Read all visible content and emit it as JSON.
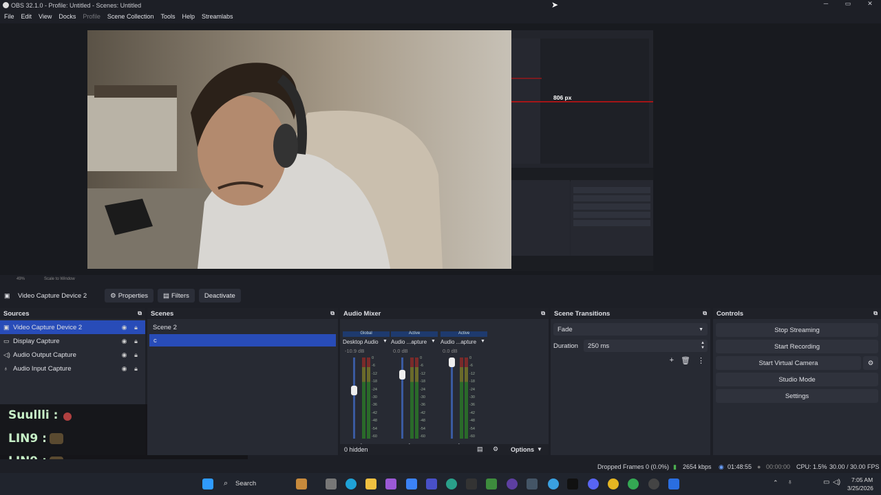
{
  "window": {
    "title": "OBS 32.1.0 - Profile: Untitled - Scenes: Untitled",
    "minimize": "─",
    "maximize": "▭",
    "close": "✕"
  },
  "menu": [
    "File",
    "Edit",
    "View",
    "Docks",
    "Profile",
    "Scene Collection",
    "Tools",
    "Help",
    "Streamlabs"
  ],
  "preview": {
    "overlay_label": "806 px"
  },
  "zoom": {
    "level": "49%",
    "mode": "Scale to Window"
  },
  "source_toolbar": {
    "source_name": "Video Capture Device 2",
    "properties": "Properties",
    "filters": "Filters",
    "deactivate": "Deactivate"
  },
  "sources": {
    "title": "Sources",
    "items": [
      {
        "name": "Video Capture Device 2",
        "icon": "camera-icon"
      },
      {
        "name": "Display Capture",
        "icon": "monitor-icon"
      },
      {
        "name": "Audio Output Capture",
        "icon": "speaker-icon"
      },
      {
        "name": "Audio Input Capture",
        "icon": "microphone-icon"
      }
    ]
  },
  "scenes": {
    "title": "Scenes",
    "items": [
      "Scene 2",
      "c"
    ]
  },
  "mixer": {
    "title": "Audio Mixer",
    "channels": [
      {
        "tag": "Global",
        "name": "Desktop Audio",
        "db": "-10.9 dB",
        "level": 0.35
      },
      {
        "tag": "Active",
        "name": "Audio ...apture",
        "db": "0.0 dB",
        "level": 0.15
      },
      {
        "tag": "Active",
        "name": "Audio ...apture",
        "db": "0.0 dB",
        "level": 0.0
      }
    ],
    "scale": [
      "0",
      "-6",
      "-12",
      "-18",
      "-24",
      "-30",
      "-36",
      "-42",
      "-48",
      "-54",
      "-60"
    ],
    "hidden": "0 hidden",
    "options": "Options"
  },
  "transitions": {
    "title": "Scene Transitions",
    "type": "Fade",
    "duration_label": "Duration",
    "duration": "250 ms"
  },
  "controls": {
    "title": "Controls",
    "stop_streaming": "Stop Streaming",
    "start_recording": "Start Recording",
    "start_virtual_camera": "Start Virtual Camera",
    "studio_mode": "Studio Mode",
    "settings": "Settings"
  },
  "chat": [
    {
      "user": "Suullli :"
    },
    {
      "user": "LIN9 :"
    },
    {
      "user": "LIN9 :"
    }
  ],
  "status": {
    "dropped": "Dropped Frames 0 (0.0%)",
    "bitrate": "2654 kbps",
    "stream_time": "01:48:55",
    "rec_time": "00:00:00",
    "cpu": "CPU: 1.5%",
    "fps": "30.00 / 30.00 FPS"
  },
  "taskbar": {
    "search": "Search",
    "time": "7:05 AM",
    "date": "3/25/2026"
  }
}
